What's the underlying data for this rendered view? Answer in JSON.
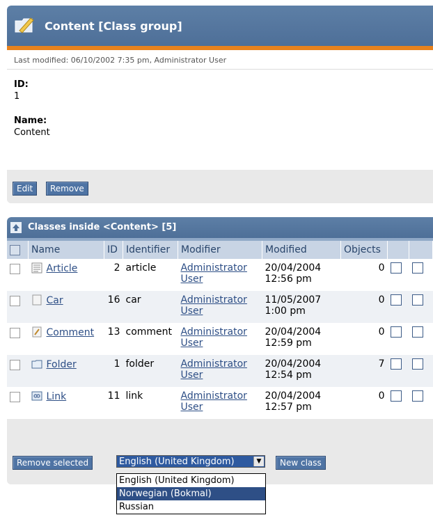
{
  "class_group": {
    "title": "Content [Class group]",
    "last_modified": "Last modified: 06/10/2002 7:35 pm, Administrator User",
    "id_label": "ID:",
    "id_value": "1",
    "name_label": "Name:",
    "name_value": "Content",
    "edit_button": "Edit",
    "remove_button": "Remove"
  },
  "classes": {
    "title": "Classes inside <Content> [5]",
    "columns": [
      "Name",
      "ID",
      "Identifier",
      "Modifier",
      "Modified",
      "Objects"
    ],
    "rows": [
      {
        "name": "Article",
        "id": "2",
        "identifier": "article",
        "modifier_1": "Administrator",
        "modifier_2": "User",
        "modified_1": "20/04/2004",
        "modified_2": "12:56 pm",
        "objects": "0",
        "icon": "article-icon"
      },
      {
        "name": "Car",
        "id": "16",
        "identifier": "car",
        "modifier_1": "Administrator",
        "modifier_2": "User",
        "modified_1": "11/05/2007",
        "modified_2": "1:00 pm",
        "objects": "0",
        "icon": "blank-doc-icon"
      },
      {
        "name": "Comment",
        "id": "13",
        "identifier": "comment",
        "modifier_1": "Administrator",
        "modifier_2": "User",
        "modified_1": "20/04/2004",
        "modified_2": "12:59 pm",
        "objects": "0",
        "icon": "comment-icon"
      },
      {
        "name": "Folder",
        "id": "1",
        "identifier": "folder",
        "modifier_1": "Administrator",
        "modifier_2": "User",
        "modified_1": "20/04/2004",
        "modified_2": "12:54 pm",
        "objects": "7",
        "icon": "folder-icon"
      },
      {
        "name": "Link",
        "id": "11",
        "identifier": "link",
        "modifier_1": "Administrator",
        "modifier_2": "User",
        "modified_1": "20/04/2004",
        "modified_2": "12:57 pm",
        "objects": "0",
        "icon": "link-icon"
      }
    ],
    "remove_selected": "Remove selected",
    "language_selected": "English (United Kingdom)",
    "language_options": [
      "English (United Kingdom)",
      "Norwegian (Bokmal)",
      "Russian"
    ],
    "new_class": "New class"
  },
  "colors": {
    "header": "#4e6f98",
    "accent": "#e8821d",
    "link": "#2e4f86"
  }
}
